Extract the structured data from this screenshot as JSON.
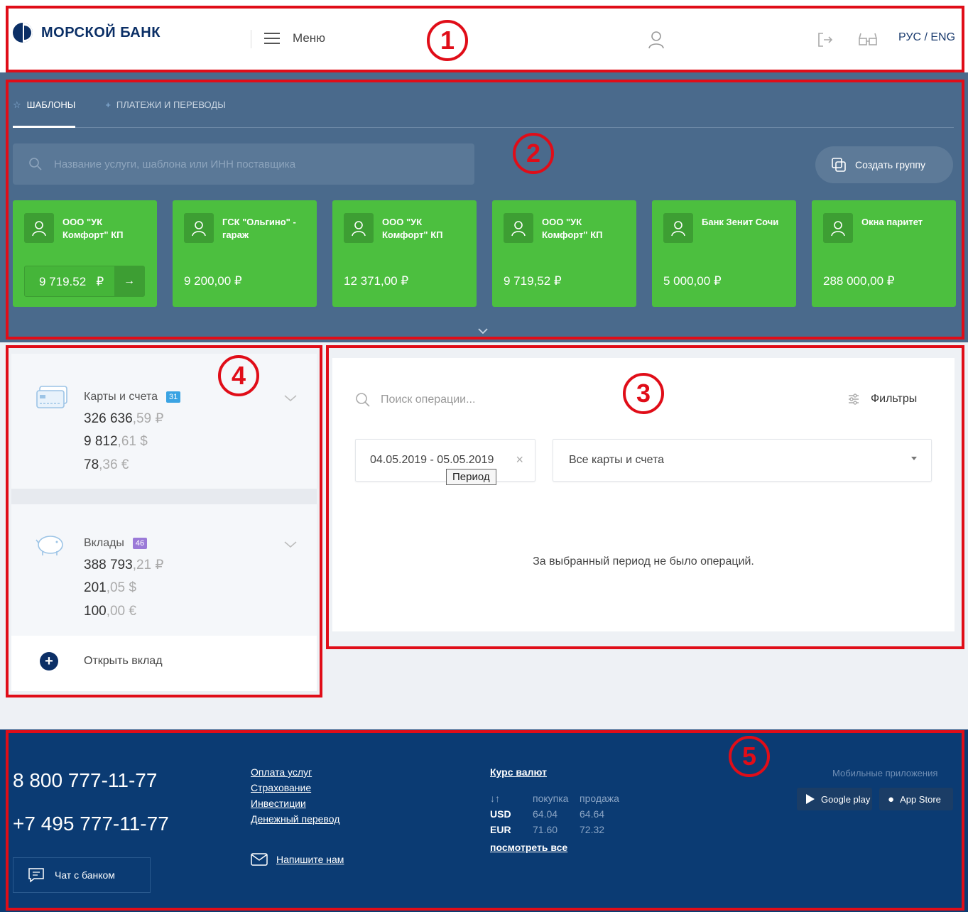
{
  "header": {
    "logo_text": "МОРСКОЙ БАНК",
    "menu_label": "Меню",
    "language": "РУС / ENG"
  },
  "templates": {
    "tabs": [
      {
        "label": "ШАБЛОНЫ",
        "active": true
      },
      {
        "label": "ПЛАТЕЖИ И ПЕРЕВОДЫ",
        "active": false
      }
    ],
    "search_placeholder": "Название услуги, шаблона или ИНН поставщика",
    "create_group_label": "Создать группу",
    "cards": [
      {
        "name": "ООО \"УК Комфорт\" КП",
        "amount": "9 719.52",
        "currency": "₽"
      },
      {
        "name": "ГСК \"Ольгино\" - гараж",
        "amount": "9 200,00 ₽"
      },
      {
        "name": "ООО \"УК Комфорт\" КП",
        "amount": "12 371,00 ₽"
      },
      {
        "name": "ООО \"УК Комфорт\" КП",
        "amount": "9 719,52 ₽"
      },
      {
        "name": "Банк Зенит Сочи",
        "amount": "5 000,00 ₽"
      },
      {
        "name": "Окна паритет",
        "amount": "288 000,00 ₽"
      }
    ],
    "accent_color": "#4cbf3f"
  },
  "accounts": {
    "cards_group": {
      "title": "Карты и счета",
      "badge": "31",
      "badge_color": "#3aa3e3",
      "balances": [
        {
          "int": "326 636",
          "dec": ",59 ₽"
        },
        {
          "int": "9 812",
          "dec": ",61 $"
        },
        {
          "int": "78",
          "dec": ",36 €"
        }
      ]
    },
    "deposits_group": {
      "title": "Вклады",
      "badge": "46",
      "badge_color": "#9b7ad8",
      "balances": [
        {
          "int": "388 793",
          "dec": ",21 ₽"
        },
        {
          "int": "201",
          "dec": ",05 $"
        },
        {
          "int": "100",
          "dec": ",00 €"
        }
      ]
    },
    "open_deposit_label": "Открыть вклад"
  },
  "operations": {
    "search_placeholder": "Поиск операции...",
    "filters_label": "Фильтры",
    "period_value": "04.05.2019 - 05.05.2019",
    "period_tooltip": "Период",
    "accounts_select": "Все карты и счета",
    "empty_message": "За выбранный период не было операций."
  },
  "footer": {
    "phones": [
      "8 800 777-11-77",
      "+7 495 777-11-77"
    ],
    "chat_label": "Чат с банком",
    "links": [
      "Оплата услуг",
      "Страхование",
      "Инвестиции",
      "Денежный перевод"
    ],
    "write_us": "Напишите нам",
    "rates": {
      "title": "Курс валют",
      "col_buy": "покупка",
      "col_sell": "продажа",
      "rows": [
        {
          "code": "USD",
          "buy": "64.04",
          "sell": "64.64"
        },
        {
          "code": "EUR",
          "buy": "71.60",
          "sell": "72.32"
        }
      ],
      "see_all": "посмотреть все"
    },
    "mobile_title": "Мобильные приложения",
    "stores": [
      "Google play",
      "App Store"
    ]
  },
  "annotations": [
    "1",
    "2",
    "3",
    "4",
    "5"
  ],
  "annotation_color": "#e00d18"
}
